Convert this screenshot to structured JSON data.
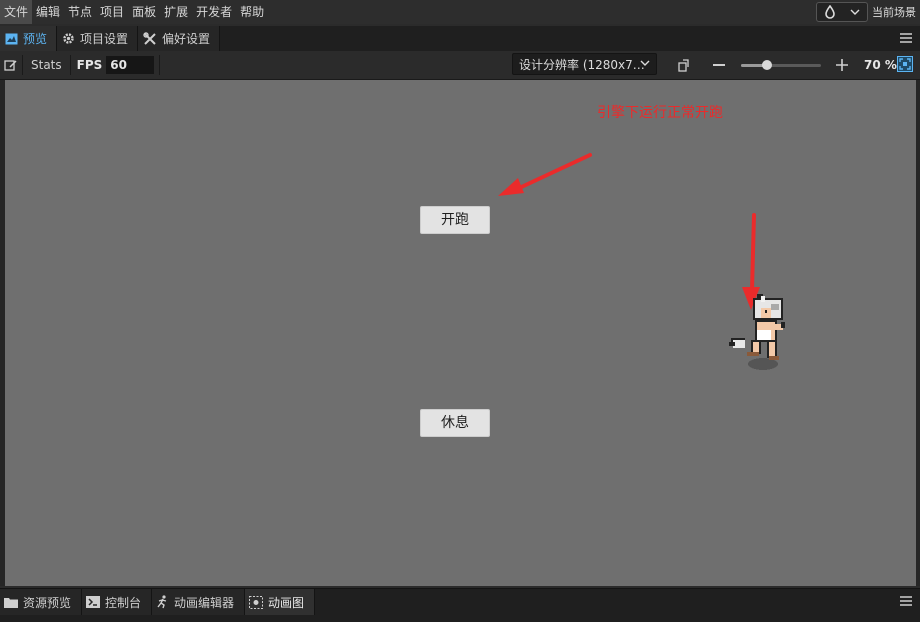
{
  "menu": {
    "items": [
      "文件",
      "编辑",
      "节点",
      "项目",
      "面板",
      "扩展",
      "开发者",
      "帮助"
    ],
    "current_scene": "当前场景"
  },
  "tabs": [
    {
      "label": "预览",
      "icon": "preview-icon",
      "active": true
    },
    {
      "label": "项目设置",
      "icon": "gear-icon",
      "active": false
    },
    {
      "label": "偏好设置",
      "icon": "tools-icon",
      "active": false
    }
  ],
  "toolbar": {
    "stats_label": "Stats",
    "fps_label": "FPS",
    "fps_value": "60",
    "resolution": "设计分辨率 (1280x7…",
    "zoom": "70 %",
    "zoom_fraction": 0.33
  },
  "game": {
    "start_button": "开跑",
    "rest_button": "休息",
    "annotation": "引擎下运行正常开跑",
    "annotation_color": "#ea2b2b"
  },
  "bottom_tabs": [
    {
      "label": "资源预览",
      "icon": "folder-icon",
      "active": false
    },
    {
      "label": "控制台",
      "icon": "terminal-icon",
      "active": false
    },
    {
      "label": "动画编辑器",
      "icon": "running-icon",
      "active": false
    },
    {
      "label": "动画图",
      "icon": "animation-graph-icon",
      "active": true
    }
  ]
}
